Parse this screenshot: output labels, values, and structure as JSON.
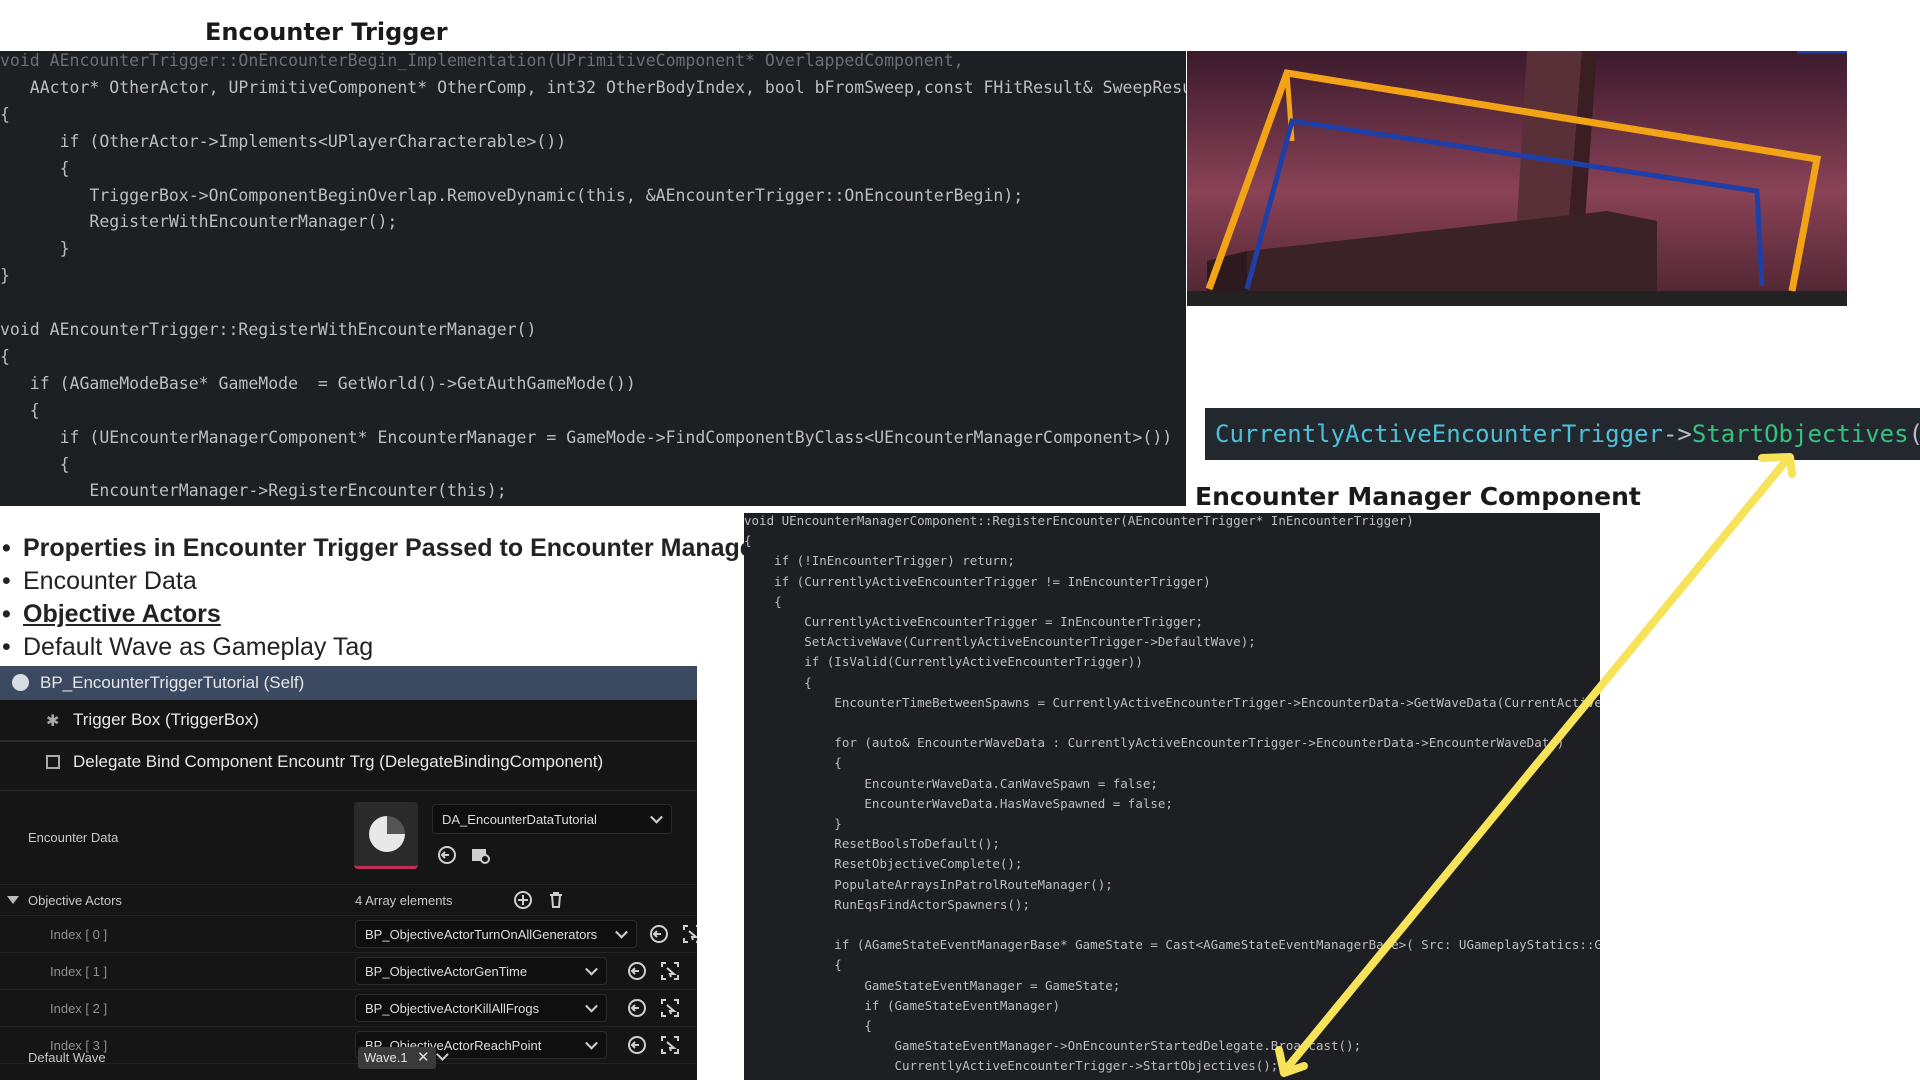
{
  "headings": {
    "encounter_trigger": "Encounter Trigger",
    "encounter_manager_component": "Encounter Manager Component"
  },
  "code_trigger": [
    {
      "cls": "dim",
      "t": "void AEncounterTrigger::OnEncounterBegin_Implementation(UPrimitiveComponent* OverlappedComponent,"
    },
    {
      "cls": "pl",
      "t": "   AActor* OtherActor, UPrimitiveComponent* OtherComp, int32 OtherBodyIndex, bool bFromSweep,const FHitResult& SweepResul"
    },
    {
      "cls": "pl",
      "t": "{"
    },
    {
      "cls": "pl",
      "t": "      if (OtherActor->Implements<UPlayerCharacterable>())"
    },
    {
      "cls": "pl",
      "t": "      {"
    },
    {
      "cls": "pl",
      "t": "         TriggerBox->OnComponentBeginOverlap.RemoveDynamic(this, &AEncounterTrigger::OnEncounterBegin);"
    },
    {
      "cls": "pl",
      "t": "         RegisterWithEncounterManager();"
    },
    {
      "cls": "pl",
      "t": "      }"
    },
    {
      "cls": "pl",
      "t": "}"
    },
    {
      "cls": "pl",
      "t": ""
    },
    {
      "cls": "pl",
      "t": "void AEncounterTrigger::RegisterWithEncounterManager()"
    },
    {
      "cls": "pl",
      "t": "{"
    },
    {
      "cls": "pl",
      "t": "   if (AGameModeBase* GameMode  = GetWorld()->GetAuthGameMode())"
    },
    {
      "cls": "pl",
      "t": "   {"
    },
    {
      "cls": "pl",
      "t": "      if (UEncounterManagerComponent* EncounterManager = GameMode->FindComponentByClass<UEncounterManagerComponent>())"
    },
    {
      "cls": "pl",
      "t": "      {"
    },
    {
      "cls": "pl",
      "t": "         EncounterManager->RegisterEncounter(this);"
    }
  ],
  "snippet": {
    "object": "CurrentlyActiveEncounterTrigger",
    "op": "->",
    "method": "StartObjectives",
    "parens": "()"
  },
  "bullets": [
    "Properties in Encounter Trigger Passed to Encounter Manager",
    "Encounter Data",
    "Objective Actors",
    "Default Wave as Gameplay Tag"
  ],
  "details": {
    "self_item": "BP_EncounterTriggerTutorial (Self)",
    "components": [
      "Trigger Box (TriggerBox)",
      "Delegate Bind Component Encountr Trg (DelegateBindingComponent)"
    ],
    "encounter_data_label": "Encounter Data",
    "encounter_data_value": "DA_EncounterDataTutorial",
    "objective_actors_label": "Objective Actors",
    "array_count": "4 Array elements",
    "indices": [
      {
        "label": "Index [ 0 ]",
        "value": "BP_ObjectiveActorTurnOnAllGenerators"
      },
      {
        "label": "Index [ 1 ]",
        "value": "BP_ObjectiveActorGenTime"
      },
      {
        "label": "Index [ 2 ]",
        "value": "BP_ObjectiveActorKillAllFrogs"
      },
      {
        "label": "Index [ 3 ]",
        "value": "BP_ObjectiveActorReachPoint"
      }
    ],
    "default_wave_label": "Default Wave",
    "default_wave_tag": "Wave.1"
  },
  "code_manager": [
    {
      "cls": "pl",
      "t": "void UEncounterManagerComponent::RegisterEncounter(AEncounterTrigger* InEncounterTrigger)"
    },
    {
      "cls": "pl",
      "t": "{"
    },
    {
      "cls": "pl",
      "t": "    if (!InEncounterTrigger) return;"
    },
    {
      "cls": "pl",
      "t": "    if (CurrentlyActiveEncounterTrigger != InEncounterTrigger)"
    },
    {
      "cls": "pl",
      "t": "    {"
    },
    {
      "cls": "pl",
      "t": "        CurrentlyActiveEncounterTrigger = InEncounterTrigger;"
    },
    {
      "cls": "pl",
      "t": "        SetActiveWave(CurrentlyActiveEncounterTrigger->DefaultWave);"
    },
    {
      "cls": "pl",
      "t": "        if (IsValid(CurrentlyActiveEncounterTrigger))"
    },
    {
      "cls": "pl",
      "t": "        {"
    },
    {
      "cls": "pl",
      "t": "            EncounterTimeBetweenSpawns = CurrentlyActiveEncounterTrigger->EncounterData->GetWaveData(CurrentActiveWav"
    },
    {
      "cls": "pl",
      "t": ""
    },
    {
      "cls": "pl",
      "t": "            for (auto& EncounterWaveData : CurrentlyActiveEncounterTrigger->EncounterData->EncounterWaveData)"
    },
    {
      "cls": "pl",
      "t": "            {"
    },
    {
      "cls": "pl",
      "t": "                EncounterWaveData.CanWaveSpawn = false;"
    },
    {
      "cls": "pl",
      "t": "                EncounterWaveData.HasWaveSpawned = false;"
    },
    {
      "cls": "pl",
      "t": "            }"
    },
    {
      "cls": "pl",
      "t": "            ResetBoolsToDefault();"
    },
    {
      "cls": "pl",
      "t": "            ResetObjectiveComplete();"
    },
    {
      "cls": "pl",
      "t": "            PopulateArraysInPatrolRouteManager();"
    },
    {
      "cls": "pl",
      "t": "            RunEqsFindActorSpawners();"
    },
    {
      "cls": "pl",
      "t": ""
    },
    {
      "cls": "pl",
      "t": "            if (AGameStateEventManagerBase* GameState = Cast<AGameStateEventManagerBase>( Src: UGameplayStatics::GetGa"
    },
    {
      "cls": "pl",
      "t": "            {"
    },
    {
      "cls": "pl",
      "t": "                GameStateEventManager = GameState;"
    },
    {
      "cls": "pl",
      "t": "                if (GameStateEventManager)"
    },
    {
      "cls": "pl",
      "t": "                {"
    },
    {
      "cls": "pl",
      "t": "                    GameStateEventManager->OnEncounterStartedDelegate.Broadcast();"
    },
    {
      "cls": "pl",
      "t": "                    CurrentlyActiveEncounterTrigger->StartObjectives();"
    }
  ],
  "colors": {
    "code_bg": "#1e1f22",
    "keyword": "#6b9bd8",
    "type": "#9c93f3",
    "function": "#35c27f",
    "plain": "#bcbec4",
    "arrow": "#f7e35a",
    "selected_row": "#3c4a61"
  },
  "icons": {
    "actor": "actor-sphere-icon",
    "trigger": "trigger-box-icon",
    "delegate": "delegate-component-icon",
    "asset": "pie-asset-thumbnail-icon",
    "use": "use-selected-arrow-icon",
    "browse": "browse-folder-icon",
    "add": "add-element-icon",
    "delete": "trash-icon",
    "pick": "pick-actor-icon"
  }
}
